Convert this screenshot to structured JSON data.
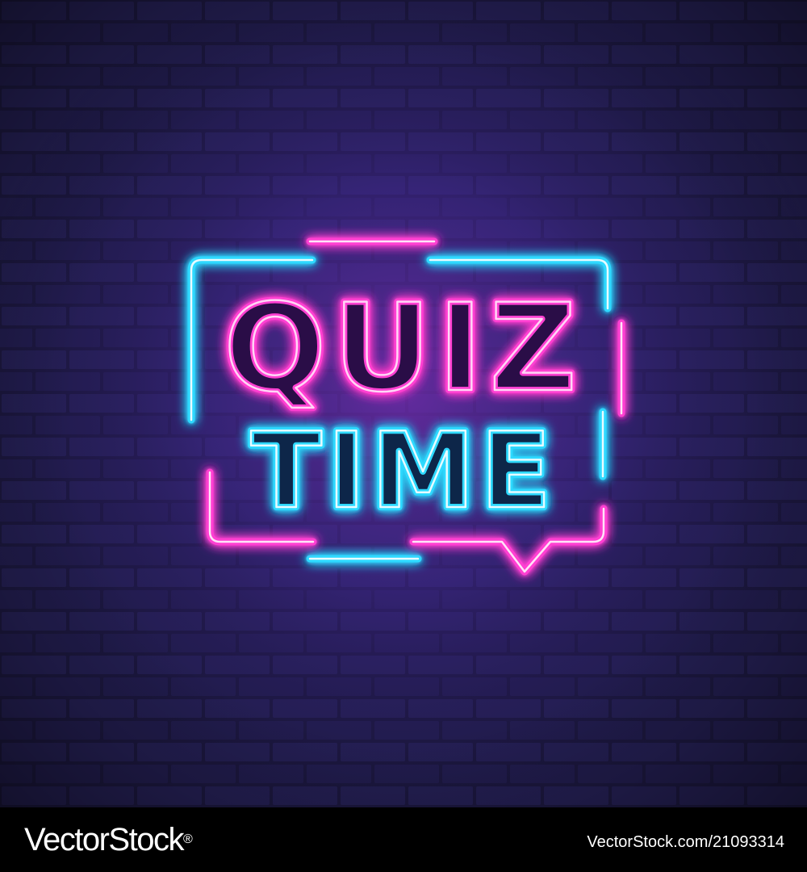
{
  "sign": {
    "line1": "QUIZ",
    "line2": "TIME"
  },
  "footer": {
    "brand": "VectorStock",
    "brand_mark": "®",
    "image_id": "VectorStock.com/21093314"
  },
  "colors": {
    "wall": "#1b1741",
    "wall_glow": "#5a2a9e",
    "neon_pink": "#ff3fd2",
    "neon_blue": "#3fe6ff",
    "footer_bg": "#000000",
    "footer_text": "#ffffff"
  }
}
